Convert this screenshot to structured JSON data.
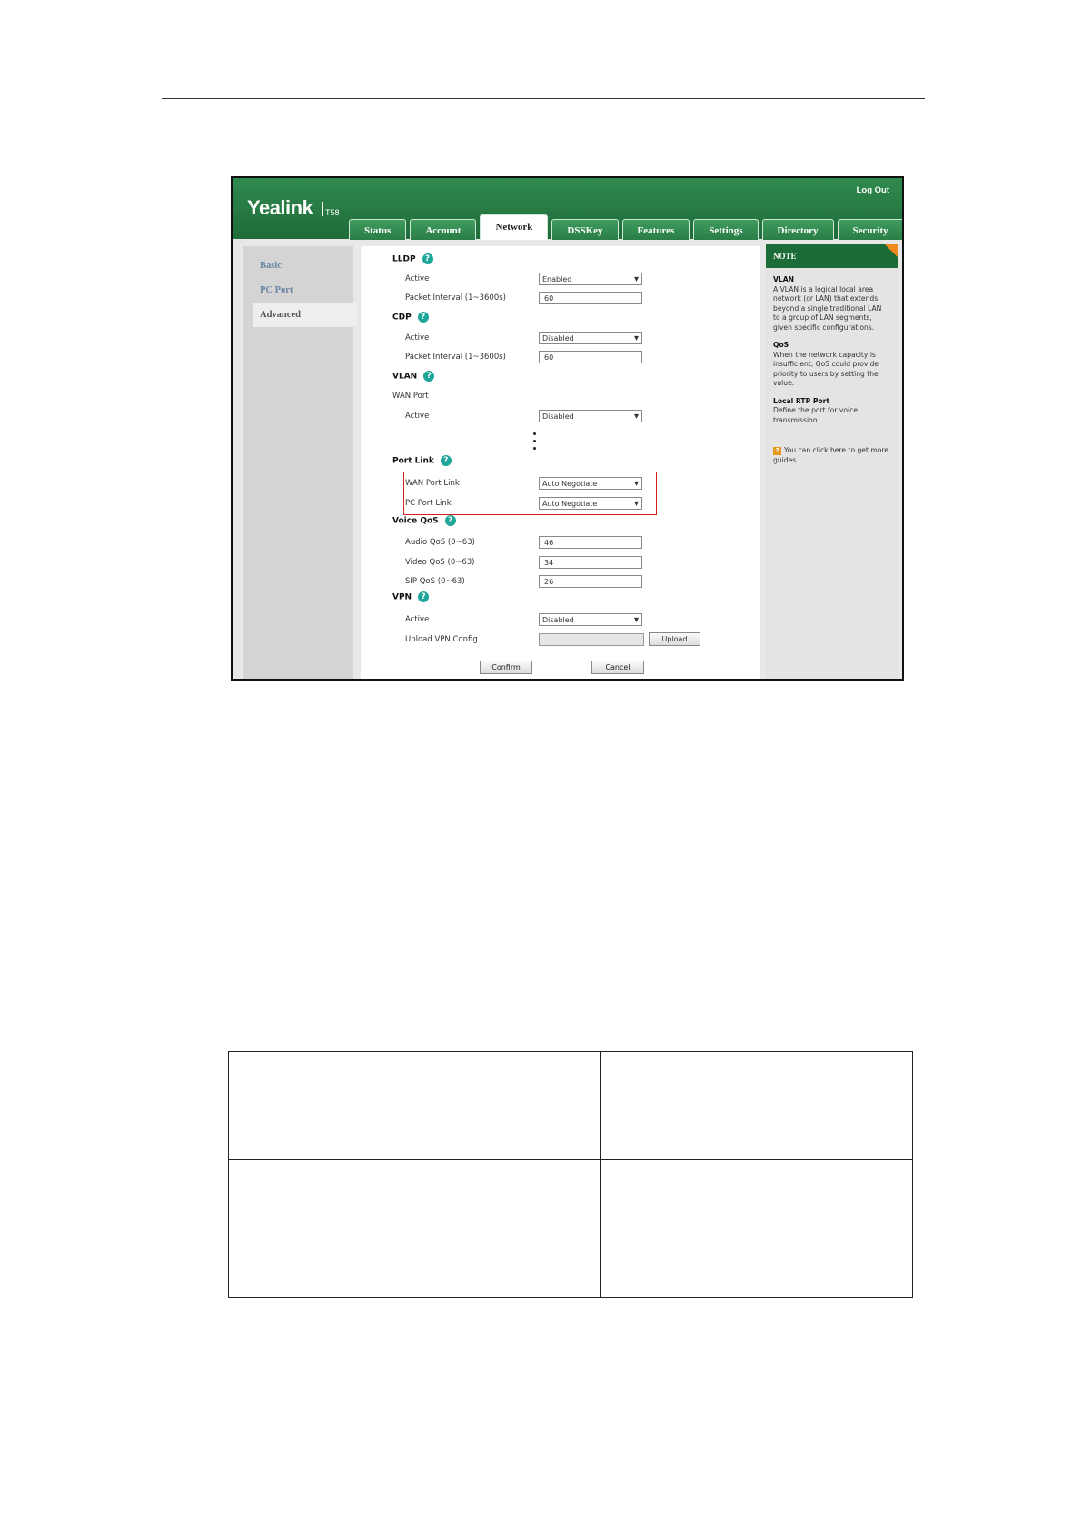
{
  "header": {
    "logo": "Yealink",
    "model": "T58",
    "logout": "Log Out",
    "tabs": [
      {
        "label": "Status"
      },
      {
        "label": "Account"
      },
      {
        "label": "Network"
      },
      {
        "label": "DSSKey"
      },
      {
        "label": "Features"
      },
      {
        "label": "Settings"
      },
      {
        "label": "Directory"
      },
      {
        "label": "Security"
      }
    ],
    "active_tab": "Network"
  },
  "sidebar": {
    "items": [
      {
        "label": "Basic"
      },
      {
        "label": "PC Port"
      },
      {
        "label": "Advanced"
      }
    ],
    "active": "Advanced"
  },
  "form": {
    "lldp": {
      "title": "LLDP",
      "active_label": "Active",
      "active_value": "Enabled",
      "interval_label": "Packet Interval (1~3600s)",
      "interval_value": "60"
    },
    "cdp": {
      "title": "CDP",
      "active_label": "Active",
      "active_value": "Disabled",
      "interval_label": "Packet Interval (1~3600s)",
      "interval_value": "60"
    },
    "vlan": {
      "title": "VLAN",
      "wan_port_label": "WAN Port",
      "active_label": "Active",
      "active_value": "Disabled"
    },
    "port_link": {
      "title": "Port Link",
      "wan_label": "WAN Port Link",
      "wan_value": "Auto Negotiate",
      "pc_label": "PC Port Link",
      "pc_value": "Auto Negotiate"
    },
    "voice_qos": {
      "title": "Voice QoS",
      "audio_label": "Audio QoS (0~63)",
      "audio_value": "46",
      "video_label": "Video QoS (0~63)",
      "video_value": "34",
      "sip_label": "SIP QoS (0~63)",
      "sip_value": "26"
    },
    "vpn": {
      "title": "VPN",
      "active_label": "Active",
      "active_value": "Disabled",
      "upload_label": "Upload VPN Config",
      "upload_button": "Upload"
    },
    "confirm": "Confirm",
    "cancel": "Cancel",
    "help_glyph": "?"
  },
  "note": {
    "title": "NOTE",
    "vlan_title": "VLAN",
    "vlan_text": "A VLAN is a logical local area network (or LAN) that extends beyond a single traditional LAN to a group of LAN segments, given specific configurations.",
    "qos_title": "QoS",
    "qos_text": "When the network capacity is insufficient, QoS could provide priority to users by setting the value.",
    "rtp_title": "Local RTP Port",
    "rtp_text": "Define the port for voice transmission.",
    "guide_icon": "?",
    "guide_text": "You can click here to get more guides."
  },
  "colors": {
    "header_green": "#2f8a4e",
    "note_header": "#1c6c37",
    "help_icon": "#1fa69a",
    "highlight_box": "#d42020"
  }
}
